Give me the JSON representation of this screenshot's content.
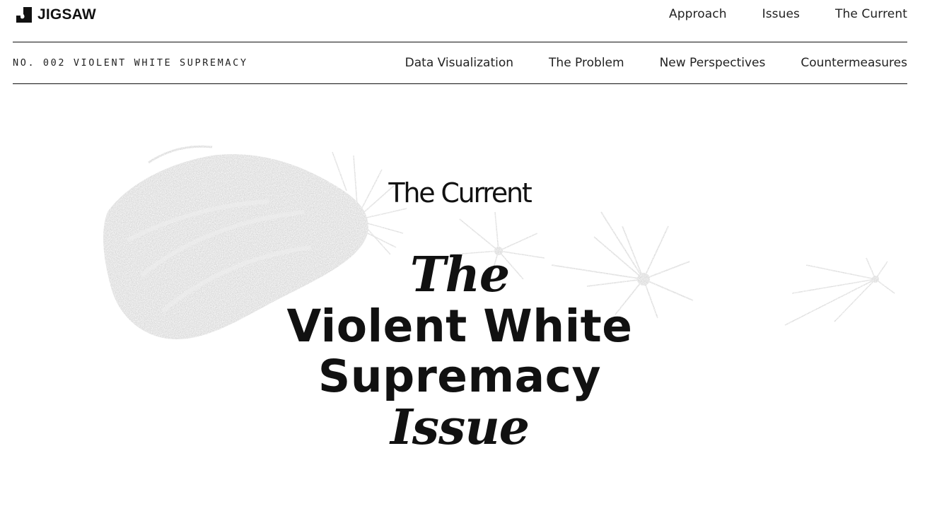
{
  "header": {
    "logo_text": "JIGSAW",
    "nav": [
      "Approach",
      "Issues",
      "The Current"
    ]
  },
  "issue_bar": {
    "label": "NO. 002 VIOLENT WHITE SUPREMACY",
    "sections": [
      "Data Visualization",
      "The Problem",
      "New Perspectives",
      "Countermeasures"
    ]
  },
  "hero": {
    "kicker": "The Current",
    "title_the": "The",
    "title_line1": "Violent White",
    "title_line2": "Supremacy",
    "title_issue": "Issue",
    "art_icon": "dandelion-seeds-illustration"
  },
  "colors": {
    "text": "#111111",
    "art_gray": "#d9d9d9",
    "background": "#ffffff"
  }
}
